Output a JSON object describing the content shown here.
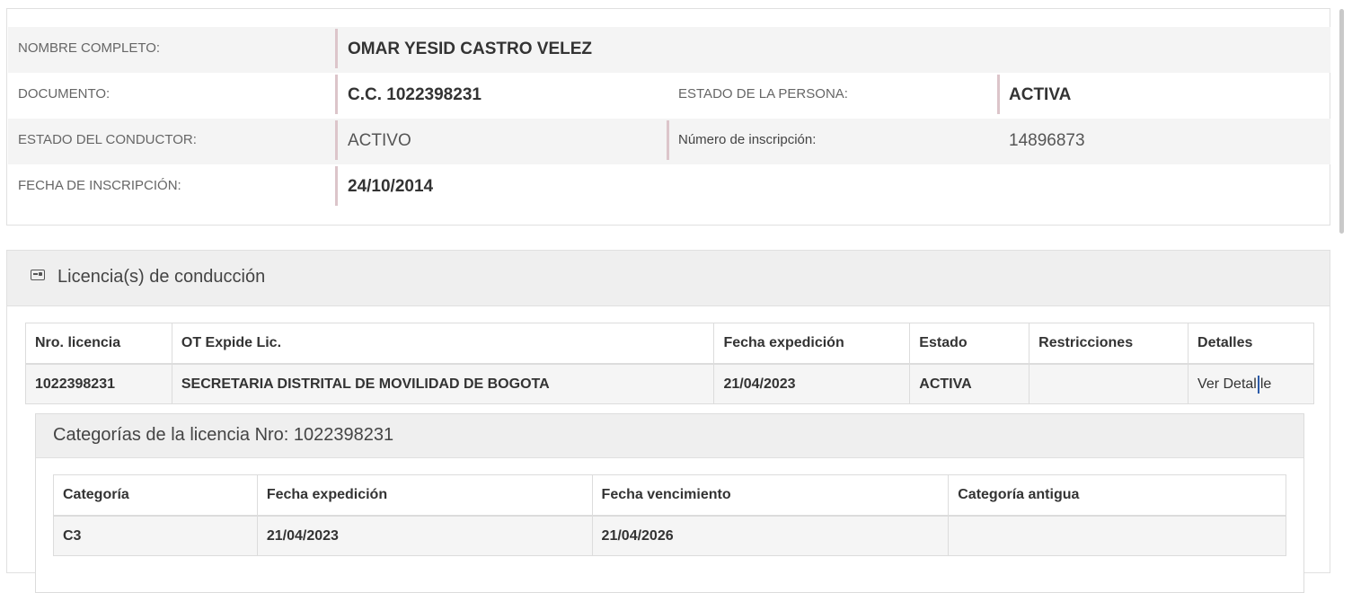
{
  "persona": {
    "nombre_label": "NOMBRE COMPLETO:",
    "nombre_value": "OMAR YESID CASTRO VELEZ",
    "documento_label": "DOCUMENTO:",
    "documento_value": "C.C. 1022398231",
    "estado_persona_label": "ESTADO DE LA PERSONA:",
    "estado_persona_value": "ACTIVA",
    "estado_conductor_label": "ESTADO DEL CONDUCTOR:",
    "estado_conductor_value": "ACTIVO",
    "numero_inscripcion_label": "Número de inscripción:",
    "numero_inscripcion_value": "14896873",
    "fecha_inscripcion_label": "FECHA DE INSCRIPCIÓN:",
    "fecha_inscripcion_value": "24/10/2014"
  },
  "licencias": {
    "title": "Licencia(s) de conducción",
    "icon": "id-card-icon",
    "columns": [
      "Nro. licencia",
      "OT Expide Lic.",
      "Fecha expedición",
      "Estado",
      "Restricciones",
      "Detalles"
    ],
    "row": {
      "nro": "1022398231",
      "ot": "SECRETARIA DISTRITAL DE MOVILIDAD DE BOGOTA",
      "fecha": "21/04/2023",
      "estado": "ACTIVA",
      "restricciones": "",
      "detalle_a": "Ver Detal",
      "detalle_b": "le"
    }
  },
  "categorias": {
    "title": "Categorías de la licencia Nro: 1022398231",
    "columns": [
      "Categoría",
      "Fecha expedición",
      "Fecha vencimiento",
      "Categoría antigua"
    ],
    "row": {
      "categoria": "C3",
      "fecha_expedicion": "21/04/2023",
      "fecha_vencimiento": "21/04/2026",
      "categoria_antigua": ""
    }
  }
}
